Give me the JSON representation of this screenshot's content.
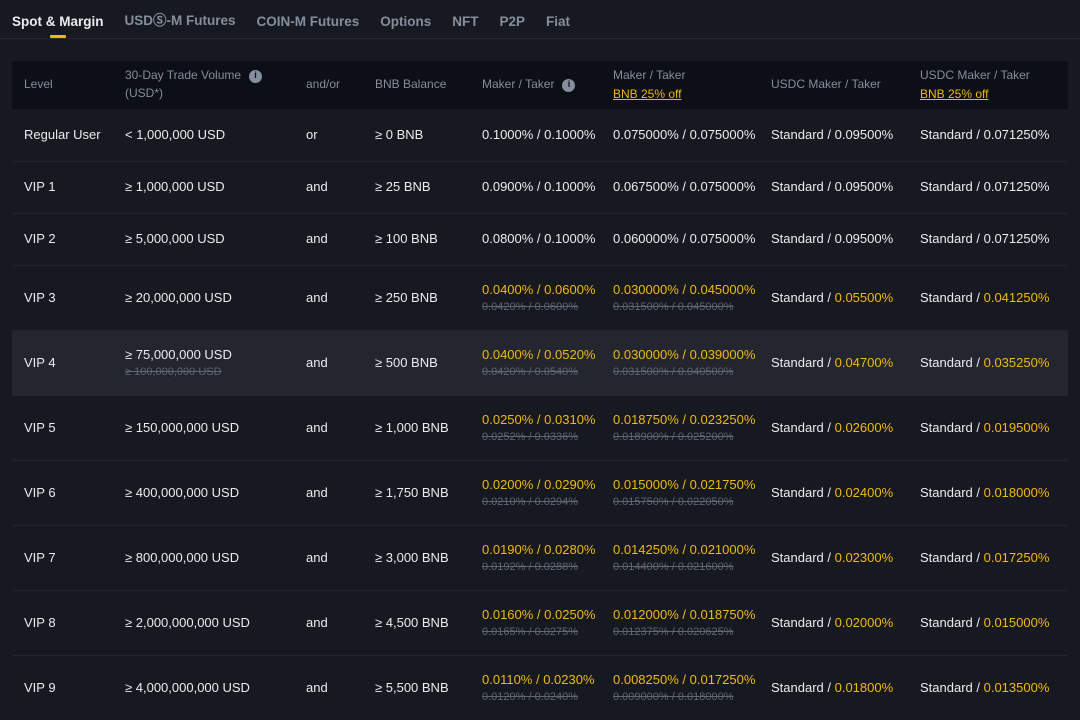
{
  "colors": {
    "accent": "#F0B90B",
    "text": "#EAECEF",
    "muted": "#848E9C",
    "strikethrough": "#5E6673",
    "header_bg": "#0C0F15",
    "highlight_row_bg": "#23262E"
  },
  "tabs": [
    {
      "label": "Spot & Margin",
      "active": true
    },
    {
      "label": "USDⓈ-M Futures",
      "active": false
    },
    {
      "label": "COIN-M Futures",
      "active": false
    },
    {
      "label": "Options",
      "active": false
    },
    {
      "label": "NFT",
      "active": false
    },
    {
      "label": "P2P",
      "active": false
    },
    {
      "label": "Fiat",
      "active": false
    }
  ],
  "table": {
    "columns": [
      {
        "id": "level",
        "label": "Level",
        "info": false,
        "sub": null,
        "link": null
      },
      {
        "id": "volume",
        "label": "30-Day Trade Volume",
        "info": true,
        "sub": "(USD*)",
        "link": null
      },
      {
        "id": "andor",
        "label": "and/or",
        "info": false,
        "sub": null,
        "link": null
      },
      {
        "id": "bnb-balance",
        "label": "BNB Balance",
        "info": false,
        "sub": null,
        "link": null
      },
      {
        "id": "maker-taker",
        "label": "Maker / Taker",
        "info": true,
        "sub": null,
        "link": null
      },
      {
        "id": "maker-taker-bnb",
        "label": "Maker / Taker",
        "info": false,
        "sub": null,
        "link": "BNB 25% off"
      },
      {
        "id": "usdc-maker-taker",
        "label": "USDC Maker / Taker",
        "info": false,
        "sub": null,
        "link": null
      },
      {
        "id": "usdc-maker-taker-bnb",
        "label": "USDC Maker / Taker",
        "info": false,
        "sub": null,
        "link": "BNB 25% off"
      }
    ],
    "rows": [
      {
        "level": "Regular User",
        "volume": "< 1,000,000 USD",
        "volume_old": null,
        "andor": "or",
        "bnb_balance": "≥ 0 BNB",
        "maker_taker": "0.1000% / 0.1000%",
        "maker_taker_old": null,
        "maker_taker_bnb": "0.075000% / 0.075000%",
        "maker_taker_bnb_old": null,
        "usdc_prefix": "Standard / ",
        "usdc_value": "0.09500%",
        "usdc_bnb_prefix": "Standard / ",
        "usdc_bnb_value": "0.071250%",
        "discounted": false,
        "highlighted": false
      },
      {
        "level": "VIP 1",
        "volume": "≥ 1,000,000 USD",
        "volume_old": null,
        "andor": "and",
        "bnb_balance": "≥ 25 BNB",
        "maker_taker": "0.0900% / 0.1000%",
        "maker_taker_old": null,
        "maker_taker_bnb": "0.067500% / 0.075000%",
        "maker_taker_bnb_old": null,
        "usdc_prefix": "Standard / ",
        "usdc_value": "0.09500%",
        "usdc_bnb_prefix": "Standard / ",
        "usdc_bnb_value": "0.071250%",
        "discounted": false,
        "highlighted": false
      },
      {
        "level": "VIP 2",
        "volume": "≥ 5,000,000 USD",
        "volume_old": null,
        "andor": "and",
        "bnb_balance": "≥ 100 BNB",
        "maker_taker": "0.0800% / 0.1000%",
        "maker_taker_old": null,
        "maker_taker_bnb": "0.060000% / 0.075000%",
        "maker_taker_bnb_old": null,
        "usdc_prefix": "Standard / ",
        "usdc_value": "0.09500%",
        "usdc_bnb_prefix": "Standard / ",
        "usdc_bnb_value": "0.071250%",
        "discounted": false,
        "highlighted": false
      },
      {
        "level": "VIP 3",
        "volume": "≥ 20,000,000 USD",
        "volume_old": null,
        "andor": "and",
        "bnb_balance": "≥ 250 BNB",
        "maker_taker": "0.0400% / 0.0600%",
        "maker_taker_old": "0.0420% / 0.0600%",
        "maker_taker_bnb": "0.030000% / 0.045000%",
        "maker_taker_bnb_old": "0.031500% / 0.045000%",
        "usdc_prefix": "Standard / ",
        "usdc_value": "0.05500%",
        "usdc_bnb_prefix": "Standard / ",
        "usdc_bnb_value": "0.041250%",
        "discounted": true,
        "highlighted": false
      },
      {
        "level": "VIP 4",
        "volume": "≥ 75,000,000 USD",
        "volume_old": "≥ 100,000,000 USD",
        "andor": "and",
        "bnb_balance": "≥ 500 BNB",
        "maker_taker": "0.0400% / 0.0520%",
        "maker_taker_old": "0.0420% / 0.0540%",
        "maker_taker_bnb": "0.030000% / 0.039000%",
        "maker_taker_bnb_old": "0.031500% / 0.040500%",
        "usdc_prefix": "Standard / ",
        "usdc_value": "0.04700%",
        "usdc_bnb_prefix": "Standard / ",
        "usdc_bnb_value": "0.035250%",
        "discounted": true,
        "highlighted": true
      },
      {
        "level": "VIP 5",
        "volume": "≥ 150,000,000 USD",
        "volume_old": null,
        "andor": "and",
        "bnb_balance": "≥ 1,000 BNB",
        "maker_taker": "0.0250% / 0.0310%",
        "maker_taker_old": "0.0252% / 0.0336%",
        "maker_taker_bnb": "0.018750% / 0.023250%",
        "maker_taker_bnb_old": "0.018900% / 0.025200%",
        "usdc_prefix": "Standard / ",
        "usdc_value": "0.02600%",
        "usdc_bnb_prefix": "Standard / ",
        "usdc_bnb_value": "0.019500%",
        "discounted": true,
        "highlighted": false
      },
      {
        "level": "VIP 6",
        "volume": "≥ 400,000,000 USD",
        "volume_old": null,
        "andor": "and",
        "bnb_balance": "≥ 1,750 BNB",
        "maker_taker": "0.0200% / 0.0290%",
        "maker_taker_old": "0.0210% / 0.0294%",
        "maker_taker_bnb": "0.015000% / 0.021750%",
        "maker_taker_bnb_old": "0.015750% / 0.022050%",
        "usdc_prefix": "Standard / ",
        "usdc_value": "0.02400%",
        "usdc_bnb_prefix": "Standard / ",
        "usdc_bnb_value": "0.018000%",
        "discounted": true,
        "highlighted": false
      },
      {
        "level": "VIP 7",
        "volume": "≥ 800,000,000 USD",
        "volume_old": null,
        "andor": "and",
        "bnb_balance": "≥ 3,000 BNB",
        "maker_taker": "0.0190% / 0.0280%",
        "maker_taker_old": "0.0192% / 0.0288%",
        "maker_taker_bnb": "0.014250% / 0.021000%",
        "maker_taker_bnb_old": "0.014400% / 0.021600%",
        "usdc_prefix": "Standard / ",
        "usdc_value": "0.02300%",
        "usdc_bnb_prefix": "Standard / ",
        "usdc_bnb_value": "0.017250%",
        "discounted": true,
        "highlighted": false
      },
      {
        "level": "VIP 8",
        "volume": "≥ 2,000,000,000 USD",
        "volume_old": null,
        "andor": "and",
        "bnb_balance": "≥ 4,500 BNB",
        "maker_taker": "0.0160% / 0.0250%",
        "maker_taker_old": "0.0165% / 0.0275%",
        "maker_taker_bnb": "0.012000% / 0.018750%",
        "maker_taker_bnb_old": "0.012375% / 0.020625%",
        "usdc_prefix": "Standard / ",
        "usdc_value": "0.02000%",
        "usdc_bnb_prefix": "Standard / ",
        "usdc_bnb_value": "0.015000%",
        "discounted": true,
        "highlighted": false
      },
      {
        "level": "VIP 9",
        "volume": "≥ 4,000,000,000 USD",
        "volume_old": null,
        "andor": "and",
        "bnb_balance": "≥ 5,500 BNB",
        "maker_taker": "0.0110% / 0.0230%",
        "maker_taker_old": "0.0120% / 0.0240%",
        "maker_taker_bnb": "0.008250% / 0.017250%",
        "maker_taker_bnb_old": "0.009000% / 0.018000%",
        "usdc_prefix": "Standard / ",
        "usdc_value": "0.01800%",
        "usdc_bnb_prefix": "Standard / ",
        "usdc_bnb_value": "0.013500%",
        "discounted": true,
        "highlighted": false
      }
    ]
  }
}
